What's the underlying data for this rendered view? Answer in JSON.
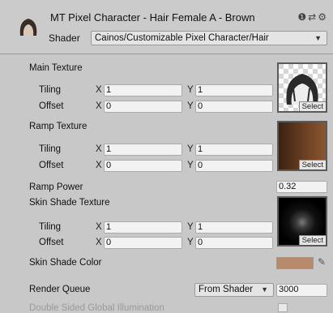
{
  "header": {
    "title": "MT Pixel Character - Hair Female A - Brown",
    "shader_label": "Shader",
    "shader_value": "Cainos/Customizable Pixel Character/Hair",
    "icons": [
      "help-icon",
      "settings-sliders-icon",
      "gear-icon"
    ]
  },
  "main_texture": {
    "label": "Main Texture",
    "tiling_label": "Tiling",
    "offset_label": "Offset",
    "x_label": "X",
    "y_label": "Y",
    "tiling_x": "1",
    "tiling_y": "1",
    "offset_x": "0",
    "offset_y": "0",
    "select_label": "Select"
  },
  "ramp_texture": {
    "label": "Ramp Texture",
    "tiling_label": "Tiling",
    "offset_label": "Offset",
    "x_label": "X",
    "y_label": "Y",
    "tiling_x": "1",
    "tiling_y": "1",
    "offset_x": "0",
    "offset_y": "0",
    "select_label": "Select"
  },
  "ramp_power": {
    "label": "Ramp Power",
    "value": "0.32"
  },
  "skin_shade_texture": {
    "label": "Skin Shade Texture",
    "tiling_label": "Tiling",
    "offset_label": "Offset",
    "x_label": "X",
    "y_label": "Y",
    "tiling_x": "1",
    "tiling_y": "1",
    "offset_x": "0",
    "offset_y": "0",
    "select_label": "Select"
  },
  "skin_shade_color": {
    "label": "Skin Shade Color",
    "color": "#b78a6c"
  },
  "render_queue": {
    "label": "Render Queue",
    "mode": "From Shader",
    "value": "3000"
  },
  "double_sided": {
    "label": "Double Sided Global Illumination"
  }
}
